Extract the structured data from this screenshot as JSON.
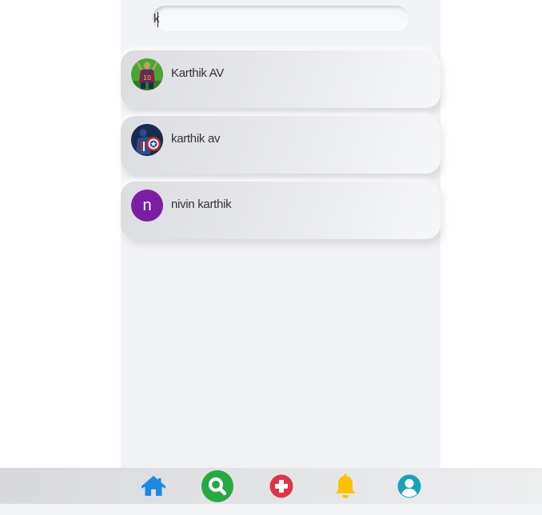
{
  "search": {
    "value": "k",
    "placeholder": ""
  },
  "results": [
    {
      "name": "Karthik AV",
      "avatar": "photo-soccer-player"
    },
    {
      "name": "karthik av",
      "avatar": "photo-captain-shield"
    },
    {
      "name": "nivin karthik",
      "avatar": "letter",
      "initial": "n"
    }
  ],
  "nav": {
    "items": [
      "home-icon",
      "search-icon",
      "add-icon",
      "bell-icon",
      "profile-icon"
    ],
    "active": "search-icon"
  },
  "colors": {
    "home": "#1e88e5",
    "search": "#27a844",
    "add": "#dc3545",
    "bell": "#ffc107",
    "profile": "#17a2b8",
    "letter_avatar": "#7b1fa2"
  }
}
